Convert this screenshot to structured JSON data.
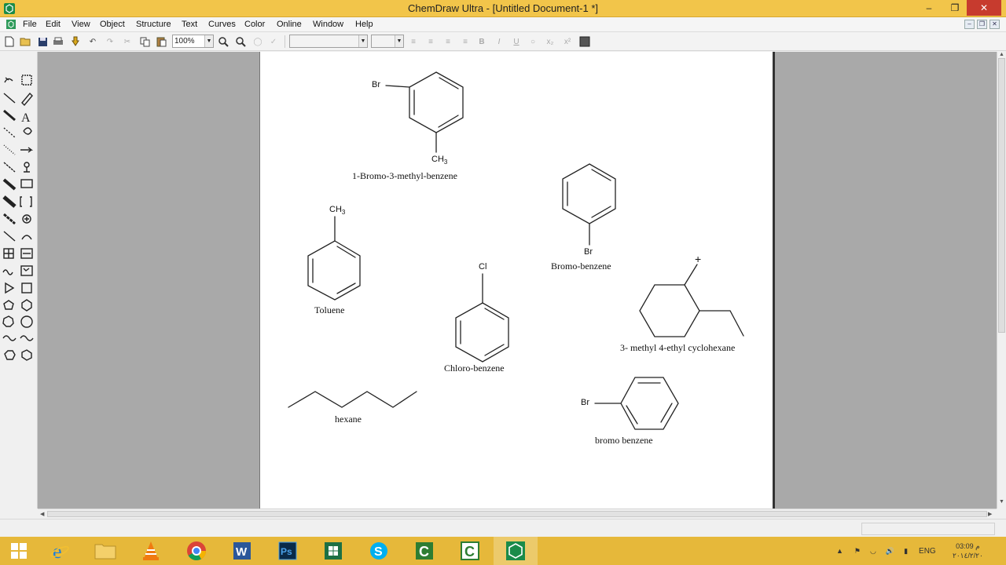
{
  "window": {
    "title": "ChemDraw Ultra - [Untitled Document-1 *]",
    "minimize": "0",
    "restore": "1",
    "close": "x"
  },
  "menu": {
    "items": [
      "File",
      "Edit",
      "View",
      "Object",
      "Structure",
      "Text",
      "Curves",
      "Color",
      "Online",
      "Window",
      "Help"
    ]
  },
  "toolbar": {
    "zoom_value": "100%",
    "bold": "B",
    "italic": "I",
    "underline": "U",
    "subscript": "x₂",
    "superscript": "x²"
  },
  "document": {
    "structures": [
      {
        "name": "1-Bromo-3-methyl-benzene",
        "substituents": [
          "Br",
          "CH3"
        ]
      },
      {
        "name": "Bromo-benzene",
        "substituents": [
          "Br"
        ]
      },
      {
        "name": "Toluene",
        "substituents": [
          "CH3"
        ]
      },
      {
        "name": "Chloro-benzene",
        "substituents": [
          "Cl"
        ]
      },
      {
        "name": "3- methyl 4-ethyl cyclohexane",
        "substituents": [
          "+"
        ]
      },
      {
        "name": "hexane",
        "substituents": []
      },
      {
        "name": "bromo benzene",
        "substituents": [
          "Br"
        ]
      }
    ],
    "atoms": {
      "br1": "Br",
      "ch3_1_main": "CH",
      "ch3_1_sub": "3",
      "br2": "Br",
      "ch3_2_main": "CH",
      "ch3_2_sub": "3",
      "cl": "Cl",
      "plus": "+",
      "br3": "Br"
    }
  },
  "taskbar": {
    "apps": [
      "start",
      "internet-explorer",
      "file-explorer",
      "vlc",
      "chrome",
      "word",
      "photoshop",
      "excel",
      "skype",
      "camtasia",
      "camtasia-recorder",
      "chemdraw"
    ],
    "language": "ENG",
    "time": "03:09 م",
    "date": "٢٠١٤/٢/٢٠"
  },
  "colors": {
    "titlebar": "#f2c54a",
    "taskbar": "#e6b83a",
    "workspace": "#a9a9a9",
    "close_button": "#c73b2e"
  }
}
